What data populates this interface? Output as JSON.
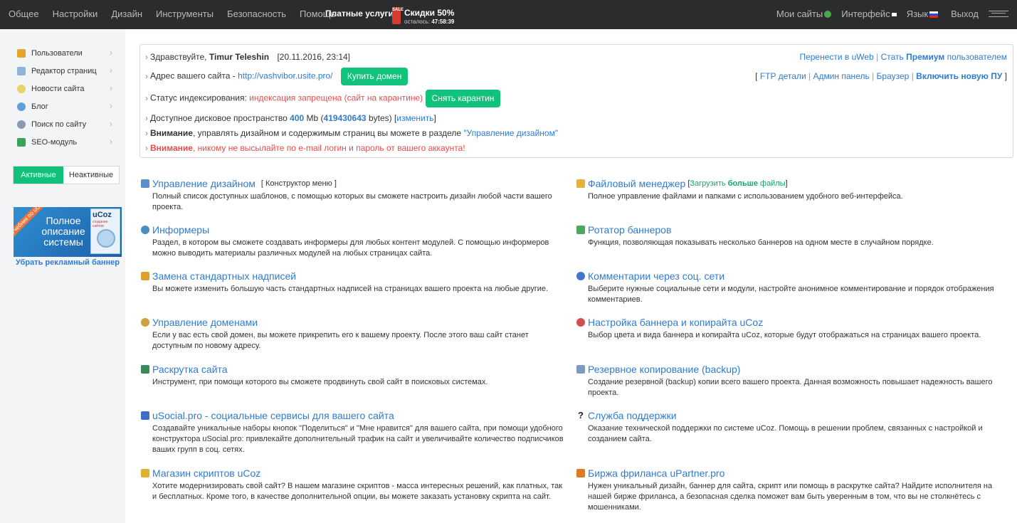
{
  "topbar": {
    "nav": [
      "Общее",
      "Настройки",
      "Дизайн",
      "Инструменты",
      "Безопасность",
      "Помощь"
    ],
    "paid_services": "Платные услуги",
    "sale_tag": "SALE",
    "discount": "Скидки 50%",
    "time_left_label": "осталось:",
    "time_left_value": "47:58:39",
    "my_sites": "Мои сайты",
    "interface": "Интерфейс",
    "language": "Язык",
    "exit": "Выход"
  },
  "sidebar": {
    "items": [
      {
        "label": "Пользователи",
        "icon": "user-icon",
        "color": "#e5a52c"
      },
      {
        "label": "Редактор страниц",
        "icon": "page-icon",
        "color": "#8fb4d8"
      },
      {
        "label": "Новости сайта",
        "icon": "bulb-icon",
        "color": "#e8d36b"
      },
      {
        "label": "Блог",
        "icon": "blog-icon",
        "color": "#5ea0d8"
      },
      {
        "label": "Поиск по сайту",
        "icon": "search-icon",
        "color": "#8a9bb0"
      },
      {
        "label": "SEO-модуль",
        "icon": "seo-icon",
        "color": "#3aa35a"
      }
    ],
    "tab_active": "Активные",
    "tab_inactive": "Неактивные",
    "ad": {
      "ribbon": "Учебник по uCoz",
      "text": "Полное описание системы",
      "book_logo": "uCoz",
      "book_sub": "создание сайтов"
    },
    "remove_banner": "Убрать рекламный баннер"
  },
  "info": {
    "greeting_prefix": "Здравствуйте,",
    "user_name": "Timur Teleshin",
    "date": "[20.11.2016, 23:14]",
    "move_uweb": "Перенести в uWeb",
    "become": "Стать",
    "premium": "Премиум",
    "user_word": "пользователем",
    "address_label": "Адрес вашего сайта -",
    "site_url": "http://vashvibor.usite.pro/",
    "buy_domain": "Купить домен",
    "ftp_details": "FTP детали",
    "admin_panel": "Админ панель",
    "browser": "Браузер",
    "enable_new_pu": "Включить новую ПУ",
    "index_label": "Статус индексирования:",
    "index_status": "индексация запрещена (сайт на карантине)",
    "remove_quarantine": "Снять карантин",
    "space_label": "Доступное дисковое пространство",
    "space_mb": "400",
    "space_unit": "Mb (",
    "space_bytes": "419430643",
    "space_bytes_unit": "bytes) [",
    "change": "изменить",
    "space_close": "]",
    "attention": "Внимание",
    "attention1_text": ", управлять дизайном и содержимым страниц вы можете в разделе",
    "design_link": "\"Управление дизайном\"",
    "attention2_text": ", никому не высылайте по e-mail логин и пароль от вашего аккаунта!"
  },
  "sections_left": [
    {
      "title": "Управление дизайном",
      "extra": "[ Конструктор меню ]",
      "icon": "design-icon",
      "color": "#5a8fc8",
      "desc": "Полный список доступных шаблонов, с помощью которых вы сможете настроить дизайн любой части вашего проекта."
    },
    {
      "title": "Информеры",
      "extra": "",
      "icon": "informer-icon",
      "color": "#4a8fc0",
      "desc": "Раздел, в котором вы сможете создавать информеры для любых контент модулей. С помощью информеров можно выводить материалы различных модулей на любых страницах сайта."
    },
    {
      "title": "Замена стандартных надписей",
      "extra": "",
      "icon": "labels-icon",
      "color": "#e0a030",
      "desc": "Вы можете изменить большую часть стандартных надписей на страницах вашего проекта на любые другие."
    },
    {
      "title": "Управление доменами",
      "extra": "",
      "icon": "domain-icon",
      "color": "#d0a040",
      "desc": "Если у вас есть свой домен, вы можете прикрепить его к вашему проекту. После этого ваш сайт станет доступным по новому адресу."
    },
    {
      "title": "Раскрутка сайта",
      "extra": "",
      "icon": "promo-icon",
      "color": "#3a8a5a",
      "desc": "Инструмент, при помощи которого вы сможете продвинуть свой сайт в поисковых системах."
    },
    {
      "title": "uSocial.pro - социальные сервисы для вашего сайта",
      "extra": "",
      "icon": "like-icon",
      "color": "#3b6fc8",
      "desc": "Создавайте уникальные наборы кнопок \"Поделиться\" и \"Мне нравится\" для вашего сайта, при помощи удобного конструктора uSocial.pro: привлекайте дополнительный трафик на сайт и увеличивайте количество подписчиков ваших групп в соц. сетях."
    },
    {
      "title": "Магазин скриптов uCoz",
      "extra": "",
      "icon": "scripts-icon",
      "color": "#e0b030",
      "desc": "Хотите модернизировать свой сайт? В нашем магазине скриптов - масса интересных решений, как платных, так и бесплатных. Кроме того, в качестве дополнительной опции, вы можете заказать установку скрипта на сайт."
    }
  ],
  "sections_right": [
    {
      "title": "Файловый менеджер",
      "extra_prefix": "[",
      "extra_link": "Загрузить",
      "extra_bold": "больше",
      "extra_link2": "файлы",
      "extra_suffix": "]",
      "icon": "folder-icon",
      "color": "#e6b040",
      "desc": "Полное управление файлами и папками с использованием удобного веб-интерфейса."
    },
    {
      "title": "Ротатор баннеров",
      "icon": "banner-icon",
      "color": "#4aa85a",
      "desc": "Функция, позволяющая показывать несколько баннеров на одном месте в случайном порядке."
    },
    {
      "title": "Комментарии через соц. сети",
      "icon": "comments-icon",
      "color": "#3a7ac8",
      "desc": "Выберите нужные социальные сети и модули, настройте анонимное комментирование и порядок отображения комментариев."
    },
    {
      "title": "Настройка баннера и копирайта uCoz",
      "icon": "copyright-icon",
      "color": "#d05050",
      "desc": "Выбор цвета и вида баннера и копирайта uCoz, которые будут отображаться на страницах вашего проекта."
    },
    {
      "title": "Резервное копирование (backup)",
      "icon": "backup-icon",
      "color": "#7a9ac0",
      "desc": "Создание резервной (backup) копии всего вашего проекта. Данная возможность повышает надежность вашего проекта."
    },
    {
      "title": "Служба поддержки",
      "icon": "question-icon",
      "color": "#222222",
      "desc": "Оказание технической поддержки по системе uCoz. Помощь в решении проблем, связанных с настройкой и созданием сайта."
    },
    {
      "title": "Биржа фриланса uPartner.pro",
      "icon": "freelance-icon",
      "color": "#e07a20",
      "desc": "Нужен уникальный дизайн, баннер для сайта, скрипт или помощь в раскрутке сайта? Найдите исполнителя на нашей бирже фриланса, а безопасная сделка поможет вам быть уверенным в том, что вы не столкнётесь с мошенниками."
    }
  ]
}
